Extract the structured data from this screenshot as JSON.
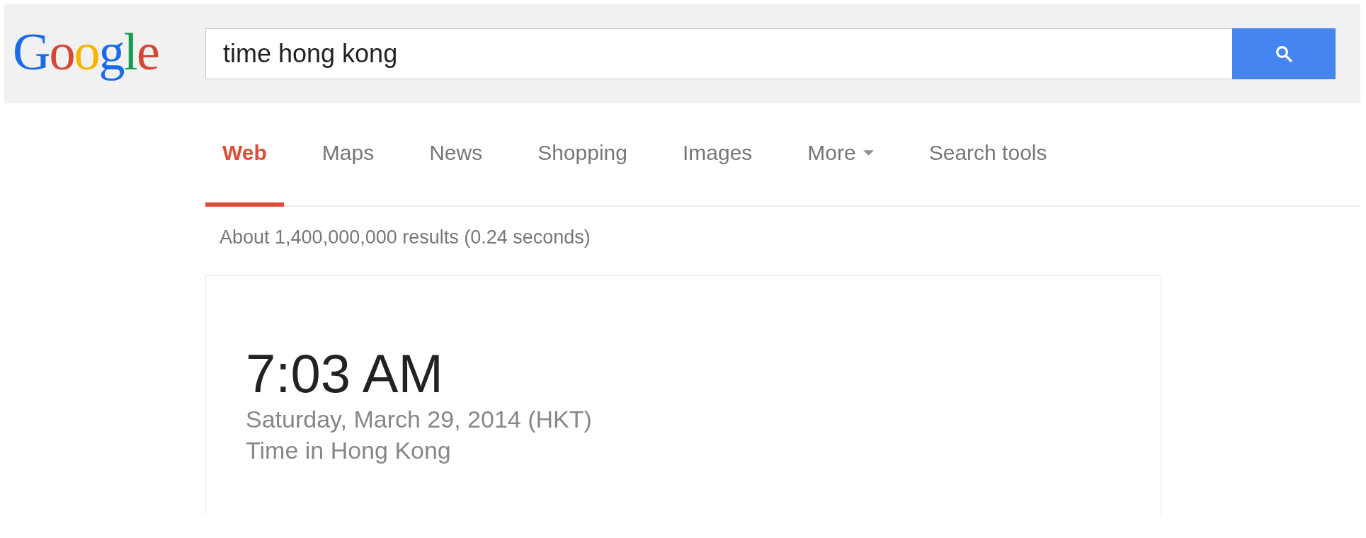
{
  "logo": "Google",
  "search": {
    "value": "time hong kong"
  },
  "tabs": [
    {
      "label": "Web",
      "selected": true
    },
    {
      "label": "Maps",
      "selected": false
    },
    {
      "label": "News",
      "selected": false
    },
    {
      "label": "Shopping",
      "selected": false
    },
    {
      "label": "Images",
      "selected": false
    },
    {
      "label": "More",
      "selected": false,
      "kind": "menu"
    },
    {
      "label": "Search tools",
      "selected": false
    }
  ],
  "result_stats": "About 1,400,000,000 results (0.24 seconds)",
  "time_card": {
    "time": "7:03 AM",
    "date": "Saturday, March 29, 2014 (HKT)",
    "caption": "Time in Hong Kong"
  }
}
